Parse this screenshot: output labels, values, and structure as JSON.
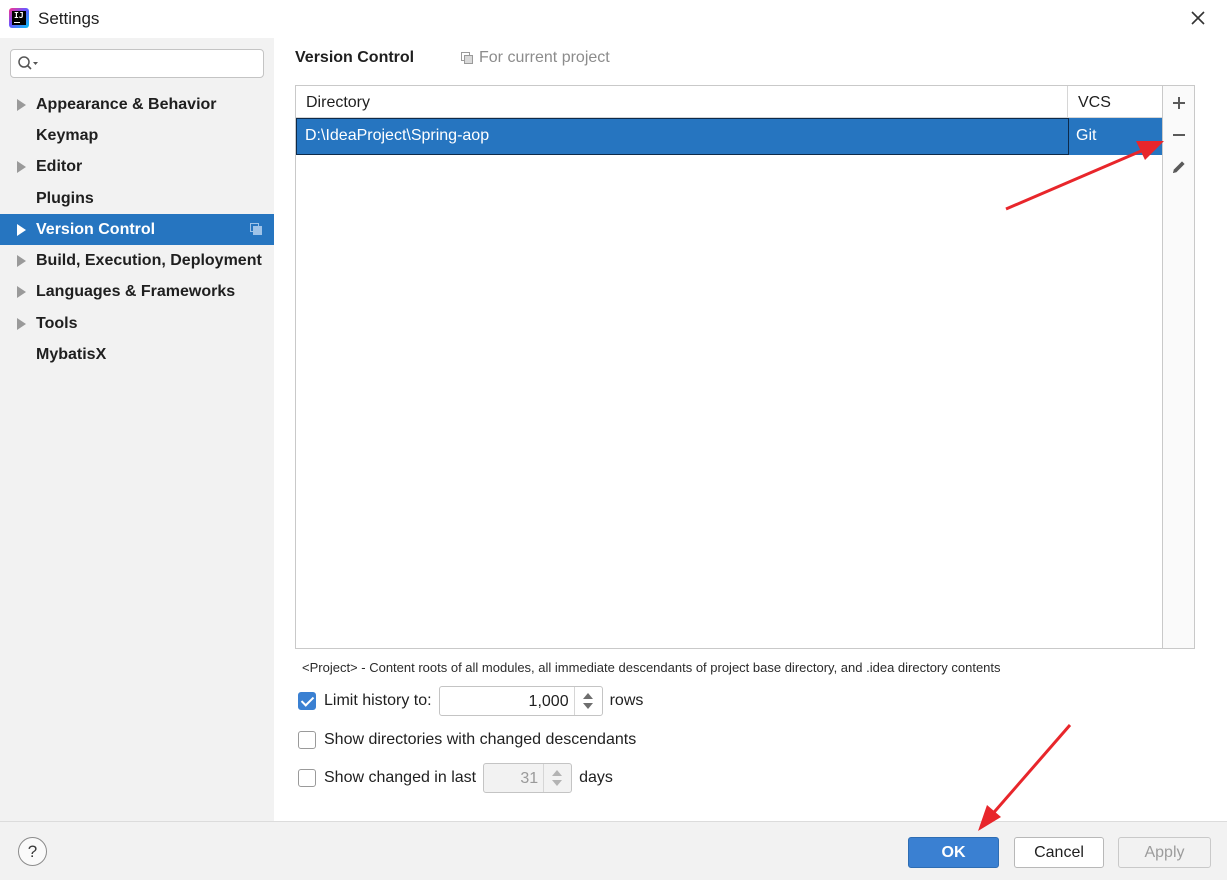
{
  "window": {
    "title": "Settings",
    "app_icon": "intellij-icon",
    "close_icon": "close-icon"
  },
  "sidebar": {
    "search": {
      "placeholder": "",
      "icon": "search-icon"
    },
    "items": [
      {
        "label": "Appearance & Behavior",
        "expandable": true,
        "selected": false
      },
      {
        "label": "Keymap",
        "expandable": false,
        "selected": false
      },
      {
        "label": "Editor",
        "expandable": true,
        "selected": false
      },
      {
        "label": "Plugins",
        "expandable": false,
        "selected": false
      },
      {
        "label": "Version Control",
        "expandable": true,
        "selected": true
      },
      {
        "label": "Build, Execution, Deployment",
        "expandable": true,
        "selected": false
      },
      {
        "label": "Languages & Frameworks",
        "expandable": true,
        "selected": false
      },
      {
        "label": "Tools",
        "expandable": true,
        "selected": false
      },
      {
        "label": "MybatisX",
        "expandable": false,
        "selected": false
      }
    ]
  },
  "main": {
    "title": "Version Control",
    "scope_label": "For current project",
    "table": {
      "columns": [
        "Directory",
        "VCS"
      ],
      "rows": [
        {
          "directory": "D:\\IdeaProject\\Spring-aop",
          "vcs": "Git",
          "selected": true
        }
      ]
    },
    "toolbar": {
      "add_icon": "plus-icon",
      "remove_icon": "minus-icon",
      "edit_icon": "pencil-icon"
    },
    "note": "<Project> - Content roots of all modules, all immediate descendants of project base directory, and .idea directory contents",
    "options": {
      "limit_history": {
        "label": "Limit history to:",
        "checked": true,
        "value": "1,000",
        "suffix": "rows"
      },
      "show_dirs": {
        "label": "Show directories with changed descendants",
        "checked": false
      },
      "show_changed": {
        "label": "Show changed in last",
        "checked": false,
        "value": "31",
        "suffix": "days"
      }
    }
  },
  "footer": {
    "help_label": "?",
    "ok_label": "OK",
    "cancel_label": "Cancel",
    "apply_label": "Apply"
  },
  "colors": {
    "accent": "#2675c0",
    "sidebar_bg": "#f2f2f2",
    "annotation": "#e8262b"
  }
}
